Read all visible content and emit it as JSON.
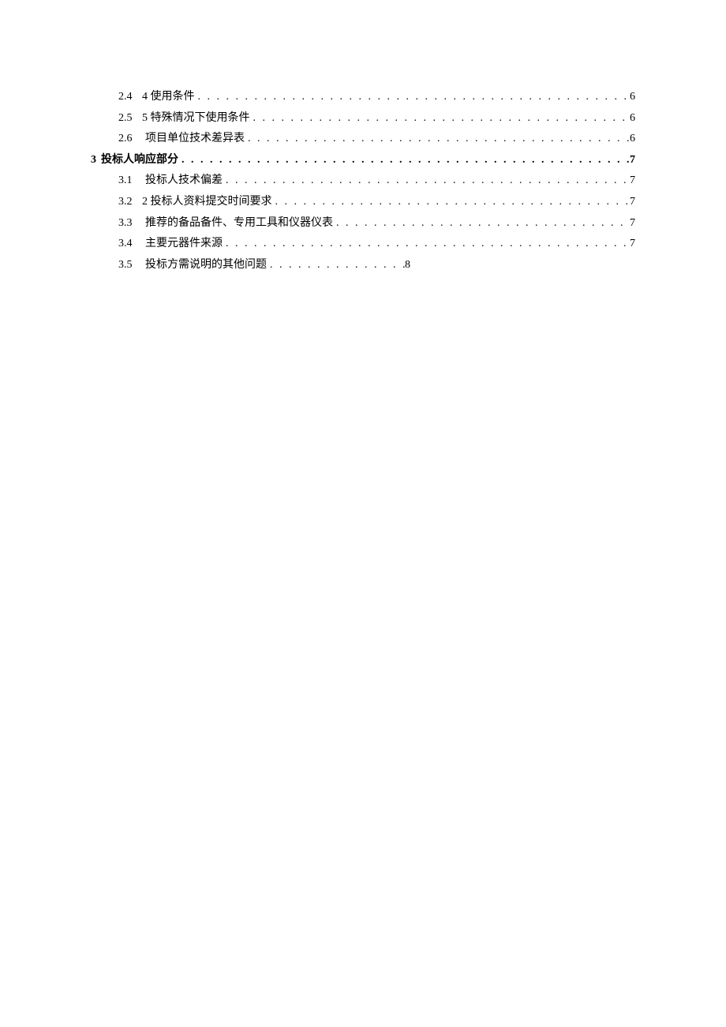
{
  "toc": {
    "entries": [
      {
        "level": "sub",
        "num": "2.4",
        "title": "4 使用条件",
        "tight": true,
        "page": "6"
      },
      {
        "level": "sub",
        "num": "2.5",
        "title": "5 特殊情况下使用条件",
        "tight": true,
        "page": "6"
      },
      {
        "level": "sub",
        "num": "2.6",
        "title": "项目单位技术差异表",
        "tight": false,
        "page": "6"
      },
      {
        "level": "section",
        "num": "3",
        "title": "投标人响应部分",
        "tight": false,
        "page": "7"
      },
      {
        "level": "sub",
        "num": "3.1",
        "title": "投标人技术偏差",
        "tight": false,
        "page": "7"
      },
      {
        "level": "sub",
        "num": "3.2",
        "title": "2 投标人资料提交时间要求",
        "tight": true,
        "page": "7"
      },
      {
        "level": "sub",
        "num": "3.3",
        "title": "推荐的备品备件、专用工具和仪器仪表",
        "tight": false,
        "page": "7"
      },
      {
        "level": "sub",
        "num": "3.4",
        "title": "主要元器件来源",
        "tight": false,
        "page": "7"
      },
      {
        "level": "sub",
        "num": "3.5",
        "title": "投标方需说明的其他问题",
        "tight": false,
        "page": "8",
        "short": true
      }
    ]
  }
}
